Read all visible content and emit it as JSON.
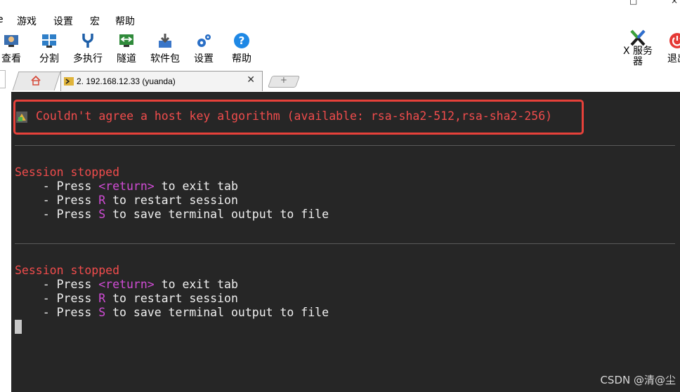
{
  "window": {
    "maximize_glyph": "□",
    "close_glyph": "×"
  },
  "menu": {
    "items": [
      "游戏",
      "设置",
      "宏",
      "帮助"
    ],
    "partial_left": "e"
  },
  "toolbar": {
    "view": "查看",
    "split": "分割",
    "multi_exec": "多执行",
    "tunnel": "隧道",
    "packages": "软件包",
    "settings": "设置",
    "help": "帮助",
    "xserver": "X 服务器",
    "exit": "退出"
  },
  "tabs": {
    "active_label": "2. 192.168.12.33 (yuanda)",
    "close_glyph": "✕",
    "add_glyph": "+"
  },
  "terminal": {
    "error_line": "Couldn't agree a host key algorithm (available: rsa-sha2-512,rsa-sha2-256)",
    "sessions": [
      {
        "stopped": "Session stopped",
        "l1_pre": "    - Press ",
        "l1_key": "<return>",
        "l1_post": " to exit tab",
        "l2_pre": "    - Press ",
        "l2_key": "R",
        "l2_post": " to restart session",
        "l3_pre": "    - Press ",
        "l3_key": "S",
        "l3_post": " to save terminal output to file"
      },
      {
        "stopped": "Session stopped",
        "l1_pre": "    - Press ",
        "l1_key": "<return>",
        "l1_post": " to exit tab",
        "l2_pre": "    - Press ",
        "l2_key": "R",
        "l2_post": " to restart session",
        "l3_pre": "    - Press ",
        "l3_key": "S",
        "l3_post": " to save terminal output to file"
      }
    ]
  },
  "watermark": "CSDN @清@尘",
  "colors": {
    "terminal_bg": "#262626",
    "error_red": "#f14c4c",
    "key_magenta": "#d14cd6",
    "highlight_box": "#e6413a"
  }
}
